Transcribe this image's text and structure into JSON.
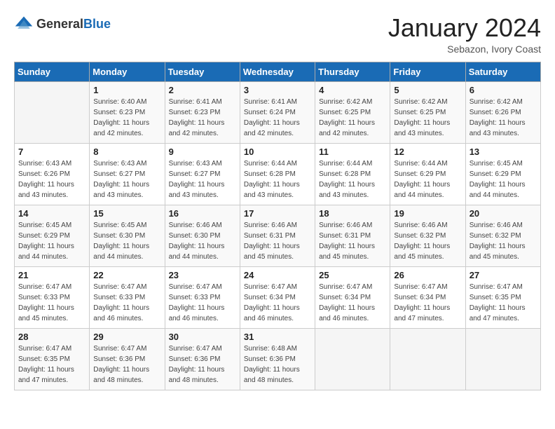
{
  "header": {
    "logo_general": "General",
    "logo_blue": "Blue",
    "month": "January 2024",
    "location": "Sebazon, Ivory Coast"
  },
  "days_of_week": [
    "Sunday",
    "Monday",
    "Tuesday",
    "Wednesday",
    "Thursday",
    "Friday",
    "Saturday"
  ],
  "weeks": [
    [
      {
        "day": "",
        "sunrise": "",
        "sunset": "",
        "daylight": ""
      },
      {
        "day": "1",
        "sunrise": "Sunrise: 6:40 AM",
        "sunset": "Sunset: 6:23 PM",
        "daylight": "Daylight: 11 hours and 42 minutes."
      },
      {
        "day": "2",
        "sunrise": "Sunrise: 6:41 AM",
        "sunset": "Sunset: 6:23 PM",
        "daylight": "Daylight: 11 hours and 42 minutes."
      },
      {
        "day": "3",
        "sunrise": "Sunrise: 6:41 AM",
        "sunset": "Sunset: 6:24 PM",
        "daylight": "Daylight: 11 hours and 42 minutes."
      },
      {
        "day": "4",
        "sunrise": "Sunrise: 6:42 AM",
        "sunset": "Sunset: 6:25 PM",
        "daylight": "Daylight: 11 hours and 42 minutes."
      },
      {
        "day": "5",
        "sunrise": "Sunrise: 6:42 AM",
        "sunset": "Sunset: 6:25 PM",
        "daylight": "Daylight: 11 hours and 43 minutes."
      },
      {
        "day": "6",
        "sunrise": "Sunrise: 6:42 AM",
        "sunset": "Sunset: 6:26 PM",
        "daylight": "Daylight: 11 hours and 43 minutes."
      }
    ],
    [
      {
        "day": "7",
        "sunrise": "Sunrise: 6:43 AM",
        "sunset": "Sunset: 6:26 PM",
        "daylight": "Daylight: 11 hours and 43 minutes."
      },
      {
        "day": "8",
        "sunrise": "Sunrise: 6:43 AM",
        "sunset": "Sunset: 6:27 PM",
        "daylight": "Daylight: 11 hours and 43 minutes."
      },
      {
        "day": "9",
        "sunrise": "Sunrise: 6:43 AM",
        "sunset": "Sunset: 6:27 PM",
        "daylight": "Daylight: 11 hours and 43 minutes."
      },
      {
        "day": "10",
        "sunrise": "Sunrise: 6:44 AM",
        "sunset": "Sunset: 6:28 PM",
        "daylight": "Daylight: 11 hours and 43 minutes."
      },
      {
        "day": "11",
        "sunrise": "Sunrise: 6:44 AM",
        "sunset": "Sunset: 6:28 PM",
        "daylight": "Daylight: 11 hours and 43 minutes."
      },
      {
        "day": "12",
        "sunrise": "Sunrise: 6:44 AM",
        "sunset": "Sunset: 6:29 PM",
        "daylight": "Daylight: 11 hours and 44 minutes."
      },
      {
        "day": "13",
        "sunrise": "Sunrise: 6:45 AM",
        "sunset": "Sunset: 6:29 PM",
        "daylight": "Daylight: 11 hours and 44 minutes."
      }
    ],
    [
      {
        "day": "14",
        "sunrise": "Sunrise: 6:45 AM",
        "sunset": "Sunset: 6:29 PM",
        "daylight": "Daylight: 11 hours and 44 minutes."
      },
      {
        "day": "15",
        "sunrise": "Sunrise: 6:45 AM",
        "sunset": "Sunset: 6:30 PM",
        "daylight": "Daylight: 11 hours and 44 minutes."
      },
      {
        "day": "16",
        "sunrise": "Sunrise: 6:46 AM",
        "sunset": "Sunset: 6:30 PM",
        "daylight": "Daylight: 11 hours and 44 minutes."
      },
      {
        "day": "17",
        "sunrise": "Sunrise: 6:46 AM",
        "sunset": "Sunset: 6:31 PM",
        "daylight": "Daylight: 11 hours and 45 minutes."
      },
      {
        "day": "18",
        "sunrise": "Sunrise: 6:46 AM",
        "sunset": "Sunset: 6:31 PM",
        "daylight": "Daylight: 11 hours and 45 minutes."
      },
      {
        "day": "19",
        "sunrise": "Sunrise: 6:46 AM",
        "sunset": "Sunset: 6:32 PM",
        "daylight": "Daylight: 11 hours and 45 minutes."
      },
      {
        "day": "20",
        "sunrise": "Sunrise: 6:46 AM",
        "sunset": "Sunset: 6:32 PM",
        "daylight": "Daylight: 11 hours and 45 minutes."
      }
    ],
    [
      {
        "day": "21",
        "sunrise": "Sunrise: 6:47 AM",
        "sunset": "Sunset: 6:33 PM",
        "daylight": "Daylight: 11 hours and 45 minutes."
      },
      {
        "day": "22",
        "sunrise": "Sunrise: 6:47 AM",
        "sunset": "Sunset: 6:33 PM",
        "daylight": "Daylight: 11 hours and 46 minutes."
      },
      {
        "day": "23",
        "sunrise": "Sunrise: 6:47 AM",
        "sunset": "Sunset: 6:33 PM",
        "daylight": "Daylight: 11 hours and 46 minutes."
      },
      {
        "day": "24",
        "sunrise": "Sunrise: 6:47 AM",
        "sunset": "Sunset: 6:34 PM",
        "daylight": "Daylight: 11 hours and 46 minutes."
      },
      {
        "day": "25",
        "sunrise": "Sunrise: 6:47 AM",
        "sunset": "Sunset: 6:34 PM",
        "daylight": "Daylight: 11 hours and 46 minutes."
      },
      {
        "day": "26",
        "sunrise": "Sunrise: 6:47 AM",
        "sunset": "Sunset: 6:34 PM",
        "daylight": "Daylight: 11 hours and 47 minutes."
      },
      {
        "day": "27",
        "sunrise": "Sunrise: 6:47 AM",
        "sunset": "Sunset: 6:35 PM",
        "daylight": "Daylight: 11 hours and 47 minutes."
      }
    ],
    [
      {
        "day": "28",
        "sunrise": "Sunrise: 6:47 AM",
        "sunset": "Sunset: 6:35 PM",
        "daylight": "Daylight: 11 hours and 47 minutes."
      },
      {
        "day": "29",
        "sunrise": "Sunrise: 6:47 AM",
        "sunset": "Sunset: 6:36 PM",
        "daylight": "Daylight: 11 hours and 48 minutes."
      },
      {
        "day": "30",
        "sunrise": "Sunrise: 6:47 AM",
        "sunset": "Sunset: 6:36 PM",
        "daylight": "Daylight: 11 hours and 48 minutes."
      },
      {
        "day": "31",
        "sunrise": "Sunrise: 6:48 AM",
        "sunset": "Sunset: 6:36 PM",
        "daylight": "Daylight: 11 hours and 48 minutes."
      },
      {
        "day": "",
        "sunrise": "",
        "sunset": "",
        "daylight": ""
      },
      {
        "day": "",
        "sunrise": "",
        "sunset": "",
        "daylight": ""
      },
      {
        "day": "",
        "sunrise": "",
        "sunset": "",
        "daylight": ""
      }
    ]
  ]
}
